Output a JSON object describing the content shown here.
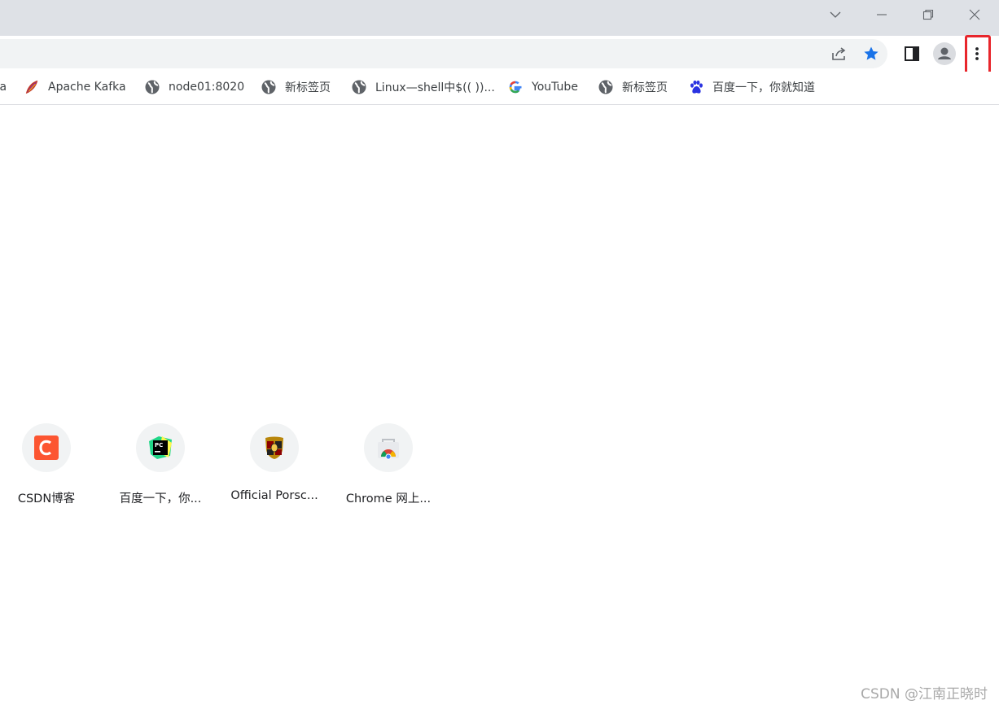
{
  "bookmarks": [
    {
      "label": "ta",
      "icon": "partial-icon"
    },
    {
      "label": "Apache Kafka",
      "icon": "kafka-feather-icon"
    },
    {
      "label": "node01:8020",
      "icon": "globe-icon"
    },
    {
      "label": "新标签页",
      "icon": "globe-icon"
    },
    {
      "label": "Linux—shell中$(( ))...",
      "icon": "globe-icon"
    },
    {
      "label": "YouTube",
      "icon": "google-g-icon"
    },
    {
      "label": "新标签页",
      "icon": "globe-icon"
    },
    {
      "label": "百度一下，你就知道",
      "icon": "baidu-paw-icon"
    }
  ],
  "shortcuts": [
    {
      "label": "CSDN博客",
      "icon": "csdn-icon"
    },
    {
      "label": "百度一下，你...",
      "icon": "pycharm-icon"
    },
    {
      "label": "Official Porsc...",
      "icon": "porsche-crest-icon"
    },
    {
      "label": "Chrome 网上...",
      "icon": "chrome-webstore-icon"
    }
  ],
  "watermark": "CSDN @江南正晓时",
  "colors": {
    "titlebar": "#dee1e6",
    "omnibox": "#f1f3f4",
    "star": "#1a73e8",
    "highlight": "#e8262c"
  }
}
